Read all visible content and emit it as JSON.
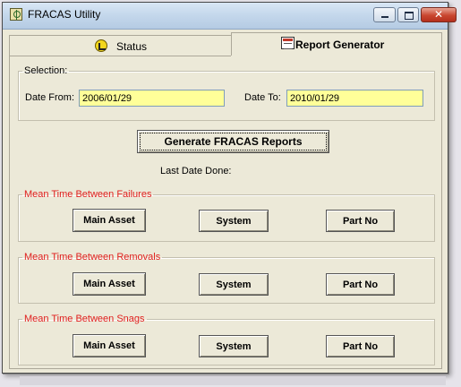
{
  "window": {
    "title": "FRACAS Utility",
    "close_glyph": "✕"
  },
  "tabs": [
    {
      "label": "Status",
      "icon": "status-icon",
      "active": false
    },
    {
      "label": "Report Generator",
      "icon": "report-generator-icon",
      "active": true
    }
  ],
  "selection": {
    "legend": "Selection:",
    "date_from_label": "Date From:",
    "date_from_value": "2006/01/29",
    "date_to_label": "Date To:",
    "date_to_value": "2010/01/29"
  },
  "generate_button_label": "Generate FRACAS Reports",
  "last_date_done_label": "Last Date Done:",
  "sections": [
    {
      "legend": "Mean Time Between Failures",
      "buttons": [
        "Main Asset",
        "System",
        "Part No"
      ]
    },
    {
      "legend": "Mean Time Between Removals",
      "buttons": [
        "Main Asset",
        "System",
        "Part No"
      ]
    },
    {
      "legend": "Mean Time Between Snags",
      "buttons": [
        "Main Asset",
        "System",
        "Part No"
      ]
    }
  ],
  "colors": {
    "section_legend": "#e0201e",
    "input_background": "#ffff99",
    "window_face": "#ece9d8"
  }
}
